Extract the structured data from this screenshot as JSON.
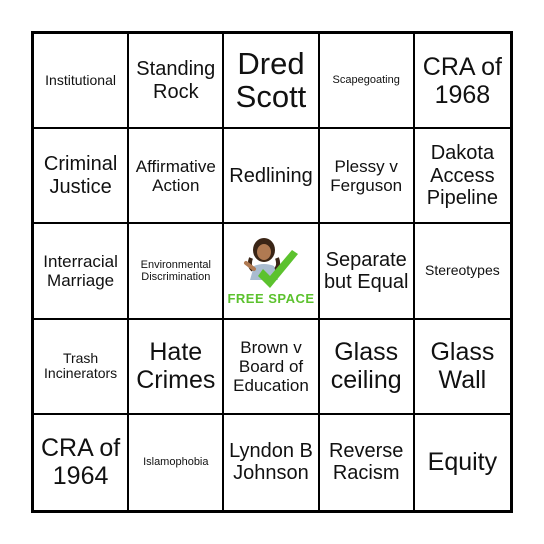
{
  "board": {
    "cells": [
      [
        "Institutional",
        "Standing Rock",
        "Dred Scott",
        "Scapegoating",
        "CRA of 1968"
      ],
      [
        "Criminal Justice",
        "Affirmative Action",
        "Redlining",
        "Plessy v Ferguson",
        "Dakota Access Pipeline"
      ],
      [
        "Interracial Marriage",
        "Environmental Discrimination",
        "FREE SPACE",
        "Separate but Equal",
        "Stereotypes"
      ],
      [
        "Trash Incinerators",
        "Hate Crimes",
        "Brown v Board of Education",
        "Glass ceiling",
        "Glass Wall"
      ],
      [
        "CRA of 1964",
        "Islamophobia",
        "Lyndon B Johnson",
        "Reverse Racism",
        "Equity"
      ]
    ],
    "free_space": {
      "label": "FREE SPACE",
      "icon": "bitmoji-checkmark-icon",
      "accent_color": "#5cc22e"
    }
  }
}
